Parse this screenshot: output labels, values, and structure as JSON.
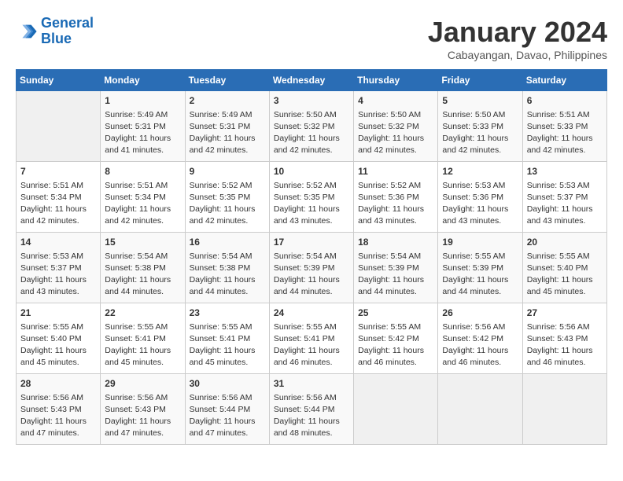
{
  "header": {
    "logo_line1": "General",
    "logo_line2": "Blue",
    "month": "January 2024",
    "location": "Cabayangan, Davao, Philippines"
  },
  "weekdays": [
    "Sunday",
    "Monday",
    "Tuesday",
    "Wednesday",
    "Thursday",
    "Friday",
    "Saturday"
  ],
  "weeks": [
    [
      {
        "day": "",
        "info": ""
      },
      {
        "day": "1",
        "info": "Sunrise: 5:49 AM\nSunset: 5:31 PM\nDaylight: 11 hours\nand 41 minutes."
      },
      {
        "day": "2",
        "info": "Sunrise: 5:49 AM\nSunset: 5:31 PM\nDaylight: 11 hours\nand 42 minutes."
      },
      {
        "day": "3",
        "info": "Sunrise: 5:50 AM\nSunset: 5:32 PM\nDaylight: 11 hours\nand 42 minutes."
      },
      {
        "day": "4",
        "info": "Sunrise: 5:50 AM\nSunset: 5:32 PM\nDaylight: 11 hours\nand 42 minutes."
      },
      {
        "day": "5",
        "info": "Sunrise: 5:50 AM\nSunset: 5:33 PM\nDaylight: 11 hours\nand 42 minutes."
      },
      {
        "day": "6",
        "info": "Sunrise: 5:51 AM\nSunset: 5:33 PM\nDaylight: 11 hours\nand 42 minutes."
      }
    ],
    [
      {
        "day": "7",
        "info": "Sunrise: 5:51 AM\nSunset: 5:34 PM\nDaylight: 11 hours\nand 42 minutes."
      },
      {
        "day": "8",
        "info": "Sunrise: 5:51 AM\nSunset: 5:34 PM\nDaylight: 11 hours\nand 42 minutes."
      },
      {
        "day": "9",
        "info": "Sunrise: 5:52 AM\nSunset: 5:35 PM\nDaylight: 11 hours\nand 42 minutes."
      },
      {
        "day": "10",
        "info": "Sunrise: 5:52 AM\nSunset: 5:35 PM\nDaylight: 11 hours\nand 43 minutes."
      },
      {
        "day": "11",
        "info": "Sunrise: 5:52 AM\nSunset: 5:36 PM\nDaylight: 11 hours\nand 43 minutes."
      },
      {
        "day": "12",
        "info": "Sunrise: 5:53 AM\nSunset: 5:36 PM\nDaylight: 11 hours\nand 43 minutes."
      },
      {
        "day": "13",
        "info": "Sunrise: 5:53 AM\nSunset: 5:37 PM\nDaylight: 11 hours\nand 43 minutes."
      }
    ],
    [
      {
        "day": "14",
        "info": "Sunrise: 5:53 AM\nSunset: 5:37 PM\nDaylight: 11 hours\nand 43 minutes."
      },
      {
        "day": "15",
        "info": "Sunrise: 5:54 AM\nSunset: 5:38 PM\nDaylight: 11 hours\nand 44 minutes."
      },
      {
        "day": "16",
        "info": "Sunrise: 5:54 AM\nSunset: 5:38 PM\nDaylight: 11 hours\nand 44 minutes."
      },
      {
        "day": "17",
        "info": "Sunrise: 5:54 AM\nSunset: 5:39 PM\nDaylight: 11 hours\nand 44 minutes."
      },
      {
        "day": "18",
        "info": "Sunrise: 5:54 AM\nSunset: 5:39 PM\nDaylight: 11 hours\nand 44 minutes."
      },
      {
        "day": "19",
        "info": "Sunrise: 5:55 AM\nSunset: 5:39 PM\nDaylight: 11 hours\nand 44 minutes."
      },
      {
        "day": "20",
        "info": "Sunrise: 5:55 AM\nSunset: 5:40 PM\nDaylight: 11 hours\nand 45 minutes."
      }
    ],
    [
      {
        "day": "21",
        "info": "Sunrise: 5:55 AM\nSunset: 5:40 PM\nDaylight: 11 hours\nand 45 minutes."
      },
      {
        "day": "22",
        "info": "Sunrise: 5:55 AM\nSunset: 5:41 PM\nDaylight: 11 hours\nand 45 minutes."
      },
      {
        "day": "23",
        "info": "Sunrise: 5:55 AM\nSunset: 5:41 PM\nDaylight: 11 hours\nand 45 minutes."
      },
      {
        "day": "24",
        "info": "Sunrise: 5:55 AM\nSunset: 5:41 PM\nDaylight: 11 hours\nand 46 minutes."
      },
      {
        "day": "25",
        "info": "Sunrise: 5:55 AM\nSunset: 5:42 PM\nDaylight: 11 hours\nand 46 minutes."
      },
      {
        "day": "26",
        "info": "Sunrise: 5:56 AM\nSunset: 5:42 PM\nDaylight: 11 hours\nand 46 minutes."
      },
      {
        "day": "27",
        "info": "Sunrise: 5:56 AM\nSunset: 5:43 PM\nDaylight: 11 hours\nand 46 minutes."
      }
    ],
    [
      {
        "day": "28",
        "info": "Sunrise: 5:56 AM\nSunset: 5:43 PM\nDaylight: 11 hours\nand 47 minutes."
      },
      {
        "day": "29",
        "info": "Sunrise: 5:56 AM\nSunset: 5:43 PM\nDaylight: 11 hours\nand 47 minutes."
      },
      {
        "day": "30",
        "info": "Sunrise: 5:56 AM\nSunset: 5:44 PM\nDaylight: 11 hours\nand 47 minutes."
      },
      {
        "day": "31",
        "info": "Sunrise: 5:56 AM\nSunset: 5:44 PM\nDaylight: 11 hours\nand 48 minutes."
      },
      {
        "day": "",
        "info": ""
      },
      {
        "day": "",
        "info": ""
      },
      {
        "day": "",
        "info": ""
      }
    ]
  ]
}
